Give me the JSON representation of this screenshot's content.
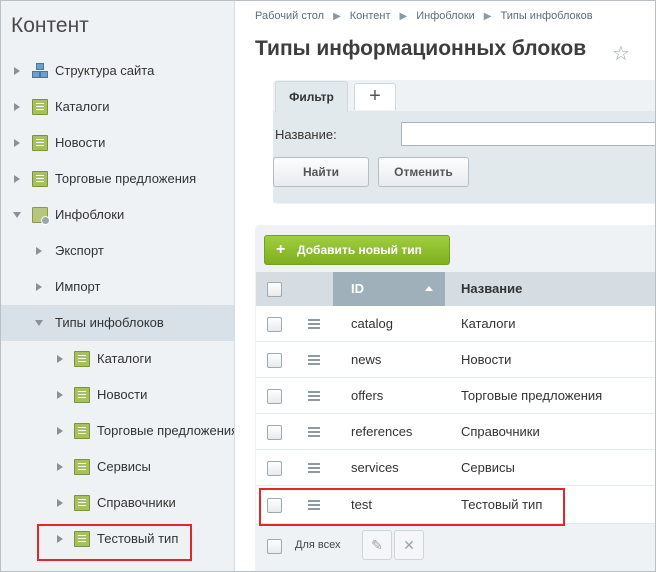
{
  "sidebar": {
    "title": "Контент",
    "items": [
      {
        "label": "Структура сайта",
        "icon": "site-structure-icon"
      },
      {
        "label": "Каталоги",
        "icon": "document-icon"
      },
      {
        "label": "Новости",
        "icon": "document-icon"
      },
      {
        "label": "Торговые предложения",
        "icon": "document-icon"
      },
      {
        "label": "Инфоблоки",
        "icon": "infoblock-icon"
      },
      {
        "label": "Экспорт"
      },
      {
        "label": "Импорт"
      },
      {
        "label": "Типы инфоблоков"
      },
      {
        "label": "Каталоги",
        "icon": "document-icon"
      },
      {
        "label": "Новости",
        "icon": "document-icon"
      },
      {
        "label": "Торговые предложения",
        "icon": "document-icon"
      },
      {
        "label": "Сервисы",
        "icon": "document-icon"
      },
      {
        "label": "Справочники",
        "icon": "document-icon"
      },
      {
        "label": "Тестовый тип",
        "icon": "document-icon"
      }
    ]
  },
  "breadcrumb": [
    "Рабочий стол",
    "Контент",
    "Инфоблоки",
    "Типы инфоблоков"
  ],
  "page": {
    "title": "Типы информационных блоков"
  },
  "filter": {
    "tab_label": "Фильтр",
    "add_tab": "+",
    "name_label": "Название:",
    "name_value": "",
    "find_button": "Найти",
    "cancel_button": "Отменить"
  },
  "add_button": "Добавить новый тип",
  "grid": {
    "columns": {
      "id": "ID",
      "name": "Название"
    },
    "rows": [
      {
        "id": "catalog",
        "name": "Каталоги"
      },
      {
        "id": "news",
        "name": "Новости"
      },
      {
        "id": "offers",
        "name": "Торговые предложения"
      },
      {
        "id": "references",
        "name": "Справочники"
      },
      {
        "id": "services",
        "name": "Сервисы"
      },
      {
        "id": "test",
        "name": "Тестовый тип"
      }
    ],
    "for_all_label": "Для всех"
  },
  "colors": {
    "accent_green": "#8bbd2f",
    "highlight_red": "#e0272b",
    "header_id_bg": "#9fb0bb"
  }
}
